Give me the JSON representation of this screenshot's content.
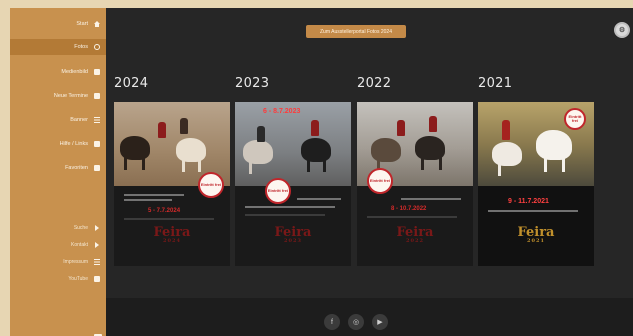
{
  "sidebar": {
    "items": [
      {
        "label": "Start",
        "icon": "home-icon"
      },
      {
        "label": "Fotos",
        "icon": "image-icon"
      },
      {
        "label": "Medienbild",
        "icon": "media-icon"
      },
      {
        "label": "Neue Termine",
        "icon": "calendar-icon"
      },
      {
        "label": "Banner",
        "icon": "flag-icon"
      },
      {
        "label": "Hilfe / Links",
        "icon": "link-icon"
      },
      {
        "label": "Favoriten",
        "icon": "bookmark-icon"
      }
    ],
    "secondary": [
      {
        "label": "Suche",
        "icon": "arrow-icon"
      },
      {
        "label": "Kontakt",
        "icon": "arrow-icon"
      },
      {
        "label": "Impressum",
        "icon": "menu-icon"
      },
      {
        "label": "YouTube",
        "icon": "video-icon"
      }
    ]
  },
  "header": {
    "action_label": "Zum Ausstellerportal Fotos 2024"
  },
  "posters": [
    {
      "year": "2024",
      "dates": "5 - 7.7.2024",
      "brand": "Feira",
      "sub": "2024"
    },
    {
      "year": "2023",
      "dates": "6 - 8.7.2023",
      "brand": "Feira",
      "sub": "2023"
    },
    {
      "year": "2022",
      "dates": "8 - 10.7.2022",
      "brand": "Feira",
      "sub": "2022"
    },
    {
      "year": "2021",
      "dates": "9 - 11.7.2021",
      "brand": "Feira",
      "sub": "2021"
    }
  ],
  "stamp_text": "Eintritt frei",
  "footer": {
    "social": [
      {
        "glyph": "f",
        "icon": "facebook-icon"
      },
      {
        "glyph": "◎",
        "icon": "instagram-icon"
      },
      {
        "glyph": "▶",
        "icon": "youtube-icon"
      }
    ]
  },
  "colors": {
    "sidebar": "#c8914e",
    "sidebar_active": "#b37a36",
    "background": "#262626",
    "accent_red": "#c0262b"
  }
}
